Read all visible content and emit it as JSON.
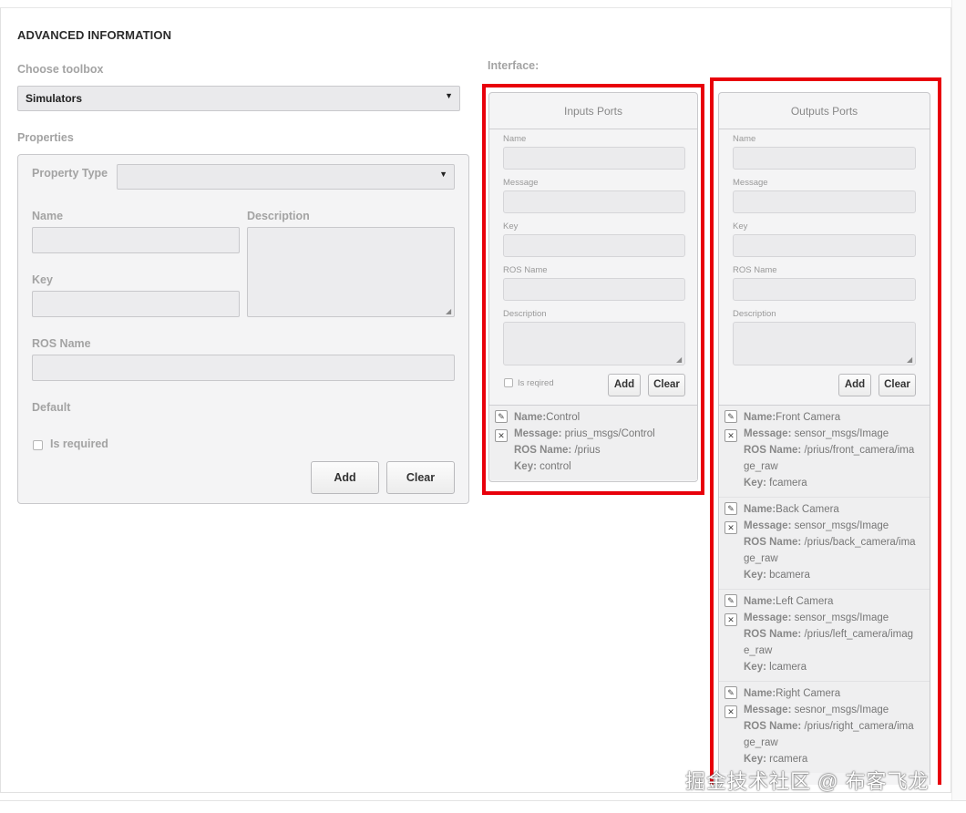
{
  "header": {
    "title": "ADVANCED INFORMATION"
  },
  "toolbox": {
    "label": "Choose toolbox",
    "selected": "Simulators"
  },
  "properties": {
    "label": "Properties",
    "property_type_label": "Property Type",
    "property_type_value": "",
    "name_label": "Name",
    "description_label": "Description",
    "key_label": "Key",
    "ros_name_label": "ROS Name",
    "default_label": "Default",
    "is_required_label": "Is required",
    "add_label": "Add",
    "clear_label": "Clear"
  },
  "interface": {
    "label": "Interface:",
    "inputs": {
      "title": "Inputs Ports",
      "name_label": "Name",
      "message_label": "Message",
      "key_label": "Key",
      "ros_name_label": "ROS Name",
      "description_label": "Description",
      "is_required_label": "Is reqired",
      "add_label": "Add",
      "clear_label": "Clear",
      "entries": [
        {
          "name_key": "Name:",
          "name": "Control",
          "message_key": "Message:",
          "message": " prius_msgs/Control",
          "ros_key": "ROS Name:",
          "ros_1": " /prius",
          "ros_2": "",
          "key_key": "Key:",
          "key": " control"
        }
      ]
    },
    "outputs": {
      "title": "Outputs Ports",
      "name_label": "Name",
      "message_label": "Message",
      "key_label": "Key",
      "ros_name_label": "ROS Name",
      "description_label": "Description",
      "add_label": "Add",
      "clear_label": "Clear",
      "entries": [
        {
          "name_key": "Name:",
          "name": "Front Camera",
          "message_key": "Message:",
          "message": " sensor_msgs/Image",
          "ros_key": "ROS Name:",
          "ros_1": " /prius/front_camera/ima",
          "ros_2": "ge_raw",
          "key_key": "Key:",
          "key": " fcamera"
        },
        {
          "name_key": "Name:",
          "name": "Back Camera",
          "message_key": "Message:",
          "message": " sensor_msgs/Image",
          "ros_key": "ROS Name:",
          "ros_1": " /prius/back_camera/ima",
          "ros_2": "ge_raw",
          "key_key": "Key:",
          "key": " bcamera"
        },
        {
          "name_key": "Name:",
          "name": "Left Camera",
          "message_key": "Message:",
          "message": " sensor_msgs/Image",
          "ros_key": "ROS Name:",
          "ros_1": " /prius/left_camera/imag",
          "ros_2": "e_raw",
          "key_key": "Key:",
          "key": " lcamera"
        },
        {
          "name_key": "Name:",
          "name": "Right Camera",
          "message_key": "Message:",
          "message": " sesnor_msgs/Image",
          "ros_key": "ROS Name:",
          "ros_1": " /prius/right_camera/ima",
          "ros_2": "ge_raw",
          "key_key": "Key:",
          "key": " rcamera"
        }
      ]
    }
  },
  "icons": {
    "edit": "pencil-icon",
    "delete": "close-icon",
    "dropdown": "caret-down-icon"
  },
  "highlight_color": "#e8000b",
  "watermark": "掘金技术社区 @ 布客飞龙"
}
